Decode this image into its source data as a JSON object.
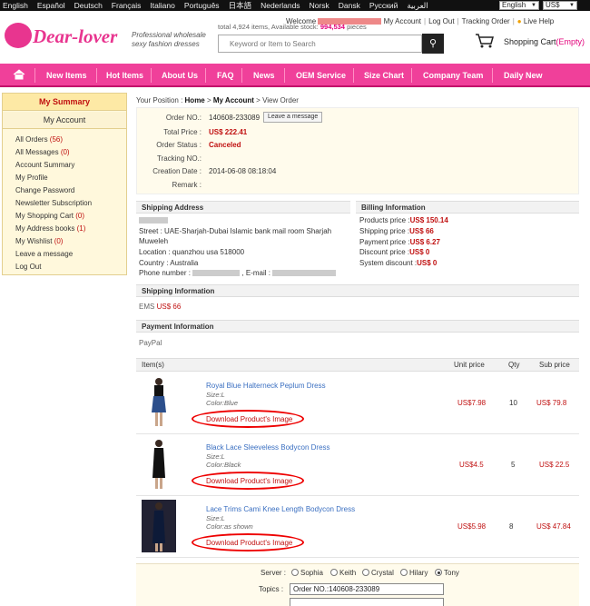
{
  "topbar": {
    "languages": [
      "English",
      "Español",
      "Deutsch",
      "Français",
      "Italiano",
      "Português",
      "日本語",
      "Nederlands",
      "Norsk",
      "Dansk",
      "Русский",
      "العربية"
    ],
    "lang_select": "English",
    "currency_select": "US$"
  },
  "header": {
    "logo": "Dear-lover",
    "tagline_line1": "Professional wholesale",
    "tagline_line2": "sexy fashion dresses",
    "stats_prefix": "total 4,924 items, Available stock:",
    "stats_stock": "994,534",
    "stats_suffix": "pieces",
    "welcome": "Welcome",
    "my_account": "My Account",
    "log_out": "Log Out",
    "tracking_order": "Tracking Order",
    "live_help": "Live Help",
    "search_placeholder": "Keyword or Item to Search",
    "cart_label": "Shopping Cart",
    "cart_status": "(Empty)"
  },
  "nav": {
    "items": [
      "New Items",
      "Hot Items",
      "About Us",
      "FAQ",
      "News",
      "OEM Service",
      "Size Chart",
      "Company Team",
      "Daily New"
    ]
  },
  "sidebar": {
    "summary": "My Summary",
    "account": "My Account",
    "links": [
      {
        "label": "All Orders",
        "count": "(56)"
      },
      {
        "label": "All Messages",
        "count": "(0)"
      },
      {
        "label": "Account Summary",
        "count": ""
      },
      {
        "label": "My Profile",
        "count": ""
      },
      {
        "label": "Change Password",
        "count": ""
      },
      {
        "label": "Newsletter Subscription",
        "count": ""
      },
      {
        "label": "My Shopping Cart",
        "count": "(0)"
      },
      {
        "label": "My Address books",
        "count": "(1)"
      },
      {
        "label": "My Wishlist",
        "count": "(0)"
      },
      {
        "label": "Leave a message",
        "count": ""
      },
      {
        "label": "Log Out",
        "count": ""
      }
    ]
  },
  "breadcrumb": {
    "prefix": "Your Position :",
    "home": "Home",
    "account": "My Account",
    "current": "View Order"
  },
  "order": {
    "no_label": "Order NO.:",
    "no_value": "140608-233089",
    "leave_message": "Leave a message",
    "total_label": "Total Price :",
    "total_value": "US$ 222.41",
    "status_label": "Order Status :",
    "status_value": "Canceled",
    "tracking_label": "Tracking NO.:",
    "tracking_value": "",
    "date_label": "Creation Date :",
    "date_value": "2014-06-08 08:18:04",
    "remark_label": "Remark :",
    "remark_value": ""
  },
  "shipping_address": {
    "title": "Shipping Address",
    "street": "Street : UAE-Sharjah-Dubai Islamic bank mail room Sharjah",
    "street2": "Muweleh",
    "location": "Location : quanzhou usa 518000",
    "country": "Country : Australia",
    "phone_label": "Phone number :",
    "email_label": ", E-mail :"
  },
  "billing": {
    "title": "Billing Information",
    "rows": [
      {
        "label": "Products price :",
        "value": "US$ 150.14"
      },
      {
        "label": "Shipping price :",
        "value": "US$ 66"
      },
      {
        "label": "Payment price :",
        "value": "US$ 6.27"
      },
      {
        "label": "Discount price :",
        "value": "US$ 0"
      },
      {
        "label": "System discount :",
        "value": "US$ 0"
      }
    ]
  },
  "shipping_info": {
    "title": "Shipping Information",
    "method": "EMS",
    "price": "US$ 66"
  },
  "payment_info": {
    "title": "Payment Information",
    "method": "PayPal"
  },
  "items_table": {
    "headers": [
      "Item(s)",
      "Unit price",
      "Qty",
      "Sub price"
    ],
    "download_label": "Download Product's Image",
    "rows": [
      {
        "name": "Royal Blue Halterneck Peplum Dress",
        "size": "Size:L",
        "color": "Color:Blue",
        "unit": "US$7.98",
        "qty": "10",
        "sub": "US$ 79.8"
      },
      {
        "name": "Black Lace Sleeveless Bodycon Dress",
        "size": "Size:L",
        "color": "Color:Black",
        "unit": "US$4.5",
        "qty": "5",
        "sub": "US$ 22.5"
      },
      {
        "name": "Lace Trims Cami Knee Length Bodycon Dress",
        "size": "Size:L",
        "color": "Color:as shown",
        "unit": "US$5.98",
        "qty": "8",
        "sub": "US$ 47.84"
      }
    ]
  },
  "message_form": {
    "server_label": "Server :",
    "servers": [
      "Sophia",
      "Keith",
      "Crystal",
      "Hilary",
      "Tony"
    ],
    "selected_server": "Tony",
    "topics_label": "Topics :",
    "topics_value": "Order NO.:140608-233089"
  },
  "colors": {
    "brand_pink": "#f0409a",
    "price_red": "#c01010",
    "link_blue": "#3a6fc1"
  }
}
